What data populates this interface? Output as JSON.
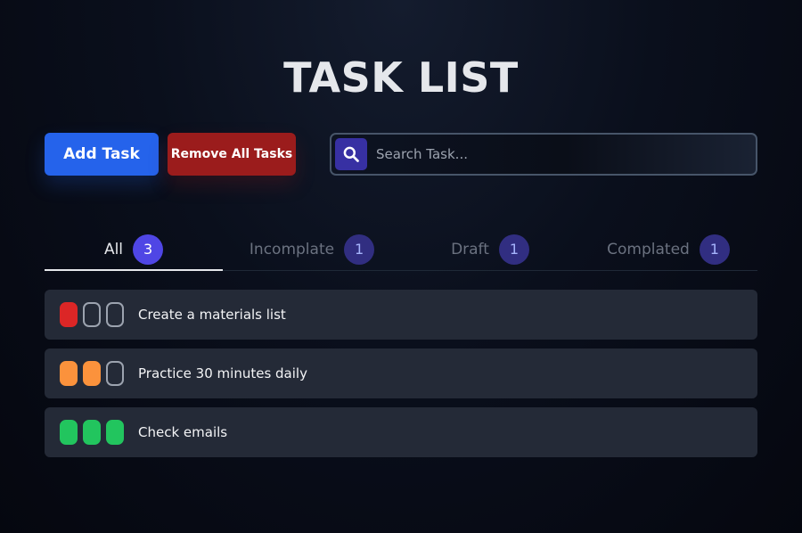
{
  "header": {
    "title": "TASK LIST"
  },
  "toolbar": {
    "add_label": "Add Task",
    "remove_label": "Remove All Tasks",
    "search_placeholder": "Search Task...",
    "search_value": "",
    "search_icon": "search-icon"
  },
  "tabs": [
    {
      "label": "All",
      "count": "3",
      "active": true
    },
    {
      "label": "Incomplate",
      "count": "1",
      "active": false
    },
    {
      "label": "Draft",
      "count": "1",
      "active": false
    },
    {
      "label": "Complated",
      "count": "1",
      "active": false
    }
  ],
  "colors": {
    "low": "#dc2626",
    "medium": "#fb923c",
    "high": "#22c55e",
    "empty_outline": "#9ca3af"
  },
  "tasks": [
    {
      "text": "Create a materials list",
      "level": 1,
      "color": "#dc2626"
    },
    {
      "text": "Practice 30 minutes daily",
      "level": 2,
      "color": "#fb923c"
    },
    {
      "text": "Check emails",
      "level": 3,
      "color": "#22c55e"
    }
  ]
}
